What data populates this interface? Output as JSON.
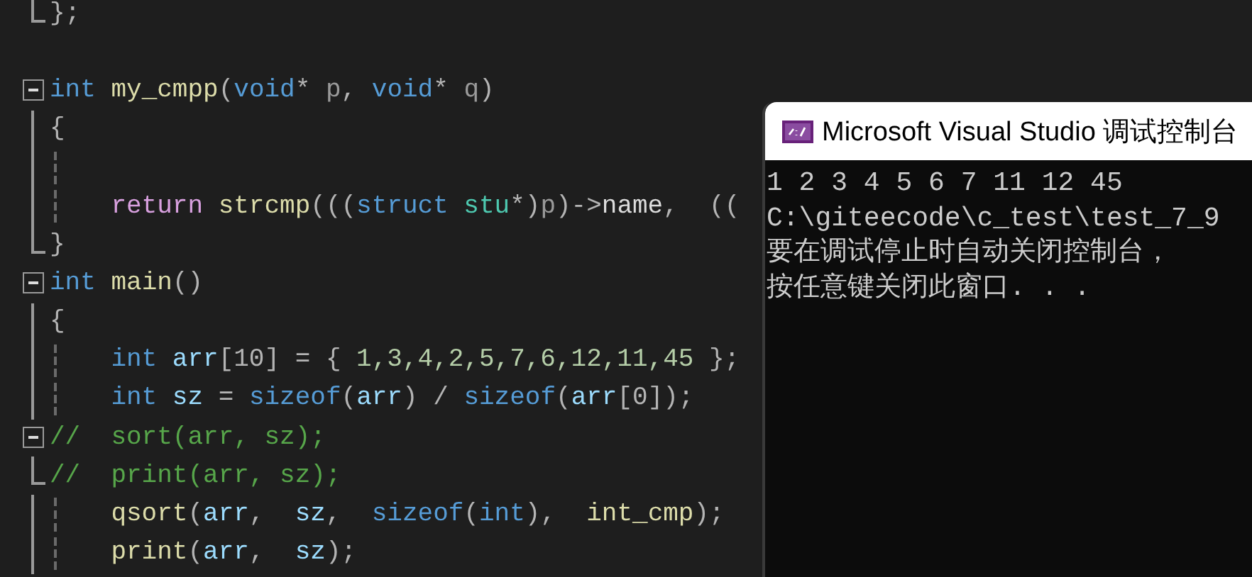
{
  "editor": {
    "lines": [
      {
        "kind": "fold_end",
        "indented": false,
        "tokens": [
          {
            "text": "};",
            "kind": "punct"
          }
        ]
      },
      {
        "kind": "blank"
      },
      {
        "kind": "fold_start",
        "indented": false,
        "tokens": [
          {
            "text": "int ",
            "kind": "keyword"
          },
          {
            "text": "my_cmpp",
            "kind": "func"
          },
          {
            "text": "(",
            "kind": "punct"
          },
          {
            "text": "void",
            "kind": "keyword"
          },
          {
            "text": "* ",
            "kind": "punct"
          },
          {
            "text": "p",
            "kind": "param"
          },
          {
            "text": ", ",
            "kind": "punct"
          },
          {
            "text": "void",
            "kind": "keyword"
          },
          {
            "text": "* ",
            "kind": "punct"
          },
          {
            "text": "q",
            "kind": "param"
          },
          {
            "text": ")",
            "kind": "punct"
          }
        ]
      },
      {
        "kind": "fold_body",
        "indented": false,
        "tokens": [
          {
            "text": "{",
            "kind": "punct"
          }
        ]
      },
      {
        "kind": "fold_body",
        "indented": true
      },
      {
        "kind": "fold_body",
        "indented": true,
        "tokens": [
          {
            "text": "return ",
            "kind": "control"
          },
          {
            "text": "strcmp",
            "kind": "func"
          },
          {
            "text": "(((",
            "kind": "punct"
          },
          {
            "text": "struct ",
            "kind": "keyword"
          },
          {
            "text": "stu",
            "kind": "type"
          },
          {
            "text": "*)",
            "kind": "punct"
          },
          {
            "text": "p",
            "kind": "param"
          },
          {
            "text": ")->",
            "kind": "punct"
          },
          {
            "text": "name",
            "kind": "plain"
          },
          {
            "text": ",  ((",
            "kind": "punct"
          }
        ]
      },
      {
        "kind": "fold_end",
        "indented": false,
        "tokens": [
          {
            "text": "}",
            "kind": "punct"
          }
        ]
      },
      {
        "kind": "fold_start",
        "indented": false,
        "tokens": [
          {
            "text": "int ",
            "kind": "keyword"
          },
          {
            "text": "main",
            "kind": "func"
          },
          {
            "text": "()",
            "kind": "punct"
          }
        ]
      },
      {
        "kind": "fold_body",
        "indented": false,
        "tokens": [
          {
            "text": "{",
            "kind": "punct"
          }
        ]
      },
      {
        "kind": "fold_body",
        "indented": true,
        "tokens": [
          {
            "text": "int ",
            "kind": "keyword"
          },
          {
            "text": "arr",
            "kind": "var"
          },
          {
            "text": "[10] = { ",
            "kind": "punct"
          },
          {
            "text": "1,3,4,2,5,7,6,12,11,45",
            "kind": "number"
          },
          {
            "text": " };",
            "kind": "punct"
          }
        ]
      },
      {
        "kind": "fold_body",
        "indented": true,
        "tokens": [
          {
            "text": "int ",
            "kind": "keyword"
          },
          {
            "text": "sz",
            "kind": "var"
          },
          {
            "text": " = ",
            "kind": "punct"
          },
          {
            "text": "sizeof",
            "kind": "keyword"
          },
          {
            "text": "(",
            "kind": "punct"
          },
          {
            "text": "arr",
            "kind": "var"
          },
          {
            "text": ") / ",
            "kind": "punct"
          },
          {
            "text": "sizeof",
            "kind": "keyword"
          },
          {
            "text": "(",
            "kind": "punct"
          },
          {
            "text": "arr",
            "kind": "var"
          },
          {
            "text": "[0]);",
            "kind": "punct"
          }
        ]
      },
      {
        "kind": "fold_start",
        "indented": false,
        "tokens": [
          {
            "text": "//  sort(arr, sz);",
            "kind": "comment"
          }
        ]
      },
      {
        "kind": "fold_end",
        "indented": false,
        "tokens": [
          {
            "text": "//  print(arr, sz);",
            "kind": "comment"
          }
        ]
      },
      {
        "kind": "fold_body",
        "indented": true,
        "tokens": [
          {
            "text": "qsort",
            "kind": "func"
          },
          {
            "text": "(",
            "kind": "punct"
          },
          {
            "text": "arr",
            "kind": "var"
          },
          {
            "text": ",  ",
            "kind": "punct"
          },
          {
            "text": "sz",
            "kind": "var"
          },
          {
            "text": ",  ",
            "kind": "punct"
          },
          {
            "text": "sizeof",
            "kind": "keyword"
          },
          {
            "text": "(",
            "kind": "punct"
          },
          {
            "text": "int",
            "kind": "keyword"
          },
          {
            "text": "),  ",
            "kind": "punct"
          },
          {
            "text": "int_cmp",
            "kind": "func"
          },
          {
            "text": ");",
            "kind": "punct"
          }
        ]
      },
      {
        "kind": "fold_body",
        "indented": true,
        "tokens": [
          {
            "text": "print",
            "kind": "func"
          },
          {
            "text": "(",
            "kind": "punct"
          },
          {
            "text": "arr",
            "kind": "var"
          },
          {
            "text": ",  ",
            "kind": "punct"
          },
          {
            "text": "sz",
            "kind": "var"
          },
          {
            "text": ");",
            "kind": "punct"
          }
        ]
      }
    ]
  },
  "console": {
    "title": "Microsoft Visual Studio 调试控制台",
    "output": [
      "1 2 3 4 5 6 7 11 12 45",
      "C:\\giteecode\\c_test\\test_7_9",
      "要在调试停止时自动关闭控制台，",
      "按任意键关闭此窗口. . ."
    ]
  }
}
